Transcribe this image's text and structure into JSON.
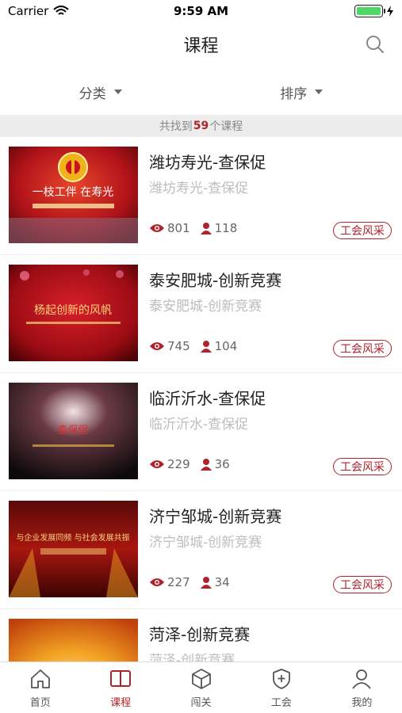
{
  "status": {
    "carrier": "Carrier",
    "time": "9:59 AM"
  },
  "nav": {
    "title": "课程"
  },
  "filters": {
    "category": "分类",
    "sort": "排序"
  },
  "results": {
    "prefix": "共找到",
    "count": "59",
    "suffix": "个课程"
  },
  "courses": [
    {
      "title": "潍坊寿光-查保促",
      "subtitle": "潍坊寿光-查保促",
      "views": "801",
      "learners": "118",
      "tag": "工会风采",
      "thumb_caption": "一枝工伴  在寿光"
    },
    {
      "title": "泰安肥城-创新竞赛",
      "subtitle": "泰安肥城-创新竞赛",
      "views": "745",
      "learners": "104",
      "tag": "工会风采",
      "thumb_caption": "杨起创新的风帆"
    },
    {
      "title": "临沂沂水-查保促",
      "subtitle": "临沂沂水-查保促",
      "views": "229",
      "learners": "36",
      "tag": "工会风采",
      "thumb_caption": "查保促"
    },
    {
      "title": "济宁邹城-创新竞赛",
      "subtitle": "济宁邹城-创新竞赛",
      "views": "227",
      "learners": "34",
      "tag": "工会风采",
      "thumb_caption": "与企业发展同频 与社会发展共振"
    },
    {
      "title": "菏泽-创新竞赛",
      "subtitle": "菏泽-创新竞赛",
      "views": "",
      "learners": "",
      "tag": "",
      "thumb_caption": ""
    }
  ],
  "tabs": [
    {
      "label": "首页",
      "icon": "home-icon"
    },
    {
      "label": "课程",
      "icon": "book-icon"
    },
    {
      "label": "闯关",
      "icon": "cube-icon"
    },
    {
      "label": "工会",
      "icon": "shield-icon"
    },
    {
      "label": "我的",
      "icon": "user-icon"
    }
  ],
  "colors": {
    "accent": "#b0232a",
    "battery": "#4cd964"
  }
}
